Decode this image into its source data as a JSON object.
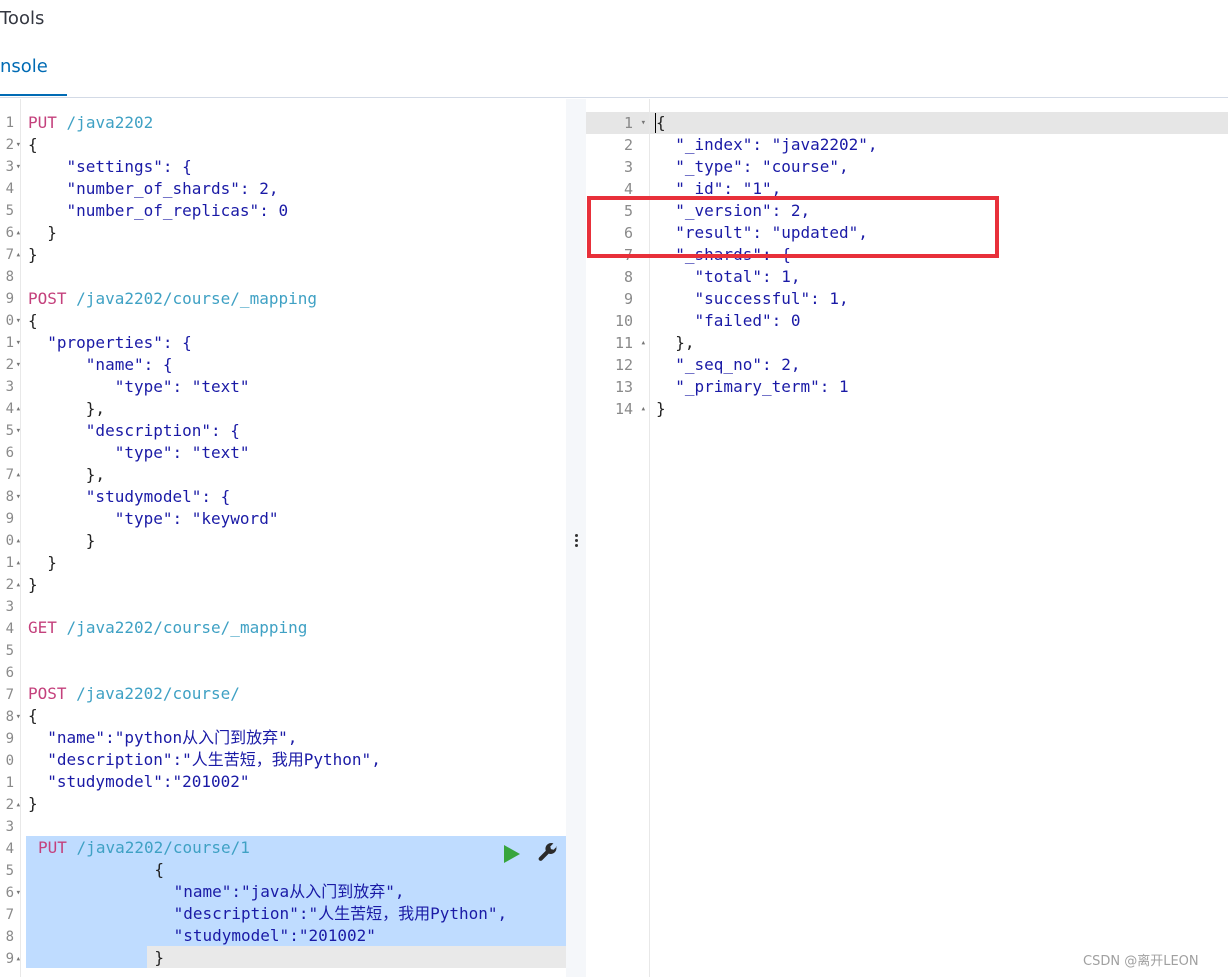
{
  "header": {
    "title": "Tools",
    "tab_label": "nsole"
  },
  "left_editor": {
    "gutter": [
      {
        "n": "1",
        "f": ""
      },
      {
        "n": "2",
        "f": "▾"
      },
      {
        "n": "3",
        "f": "▾"
      },
      {
        "n": "4",
        "f": ""
      },
      {
        "n": "5",
        "f": ""
      },
      {
        "n": "6",
        "f": "▴"
      },
      {
        "n": "7",
        "f": "▴"
      },
      {
        "n": "8",
        "f": ""
      },
      {
        "n": "9",
        "f": ""
      },
      {
        "n": "0",
        "f": "▾"
      },
      {
        "n": "1",
        "f": "▾"
      },
      {
        "n": "2",
        "f": "▾"
      },
      {
        "n": "3",
        "f": ""
      },
      {
        "n": "4",
        "f": "▴"
      },
      {
        "n": "5",
        "f": "▾"
      },
      {
        "n": "6",
        "f": ""
      },
      {
        "n": "7",
        "f": "▴"
      },
      {
        "n": "8",
        "f": "▾"
      },
      {
        "n": "9",
        "f": ""
      },
      {
        "n": "0",
        "f": "▴"
      },
      {
        "n": "1",
        "f": "▴"
      },
      {
        "n": "2",
        "f": "▴"
      },
      {
        "n": "3",
        "f": ""
      },
      {
        "n": "4",
        "f": ""
      },
      {
        "n": "5",
        "f": ""
      },
      {
        "n": "6",
        "f": ""
      },
      {
        "n": "7",
        "f": ""
      },
      {
        "n": "8",
        "f": "▾"
      },
      {
        "n": "9",
        "f": ""
      },
      {
        "n": "0",
        "f": ""
      },
      {
        "n": "1",
        "f": ""
      },
      {
        "n": "2",
        "f": "▴"
      },
      {
        "n": "3",
        "f": ""
      },
      {
        "n": "4",
        "f": ""
      },
      {
        "n": "5",
        "f": ""
      },
      {
        "n": "6",
        "f": "▾"
      },
      {
        "n": "7",
        "f": ""
      },
      {
        "n": "8",
        "f": ""
      },
      {
        "n": "9",
        "f": "▴"
      }
    ],
    "request1": {
      "method": "PUT",
      "path": "/java2202"
    },
    "req1_lines": [
      "{",
      "  \"settings\": {",
      "    \"number_of_shards\": 2,",
      "    \"number_of_replicas\": 0",
      "  }",
      "}"
    ],
    "request2": {
      "method": "POST",
      "path": "/java2202/course/_mapping"
    },
    "req2_lines": [
      "{",
      "  \"properties\": {",
      "      \"name\": {",
      "         \"type\": \"text\"",
      "      },",
      "      \"description\": {",
      "         \"type\": \"text\"",
      "      },",
      "      \"studymodel\": {",
      "         \"type\": \"keyword\"",
      "      }",
      "  }",
      "}"
    ],
    "request3": {
      "method": "GET",
      "path": "/java2202/course/_mapping"
    },
    "request4": {
      "method": "POST",
      "path": "/java2202/course/"
    },
    "req4_lines": [
      "{",
      "  \"name\":\"python从入门到放弃\",",
      "  \"description\":\"人生苦短，我用Python\",",
      "  \"studymodel\":\"201002\"",
      "}"
    ],
    "request5": {
      "method": "PUT",
      "path": "/java2202/course/1"
    },
    "req5_lines": [
      "          {",
      "            \"name\":\"java从入门到放弃\",",
      "            \"description\":\"人生苦短，我用Python\",",
      "            \"studymodel\":\"201002\"",
      "          }"
    ]
  },
  "right_editor": {
    "gutter": [
      {
        "n": "1",
        "f": "▾"
      },
      {
        "n": "2",
        "f": ""
      },
      {
        "n": "3",
        "f": ""
      },
      {
        "n": "4",
        "f": ""
      },
      {
        "n": "5",
        "f": ""
      },
      {
        "n": "6",
        "f": ""
      },
      {
        "n": "7",
        "f": ""
      },
      {
        "n": "8",
        "f": ""
      },
      {
        "n": "9",
        "f": ""
      },
      {
        "n": "10",
        "f": ""
      },
      {
        "n": "11",
        "f": "▴"
      },
      {
        "n": "12",
        "f": ""
      },
      {
        "n": "13",
        "f": ""
      },
      {
        "n": "14",
        "f": "▴"
      }
    ],
    "lines": [
      "{",
      "  \"_index\": \"java2202\",",
      "  \"_type\": \"course\",",
      "  \"_id\": \"1\",",
      "  \"_version\": 2,",
      "  \"result\": \"updated\",",
      "  \"_shards\": {",
      "    \"total\": 1,",
      "    \"successful\": 1,",
      "    \"failed\": 0",
      "  },",
      "  \"_seq_no\": 2,",
      "  \"_primary_term\": 1",
      "}"
    ]
  },
  "watermark": "CSDN @离开LEON",
  "colors": {
    "accent": "#006bb4",
    "method": "#c4407c",
    "path": "#3fa1c4",
    "highlight": "#e8303a",
    "selection": "#bfdcff"
  }
}
